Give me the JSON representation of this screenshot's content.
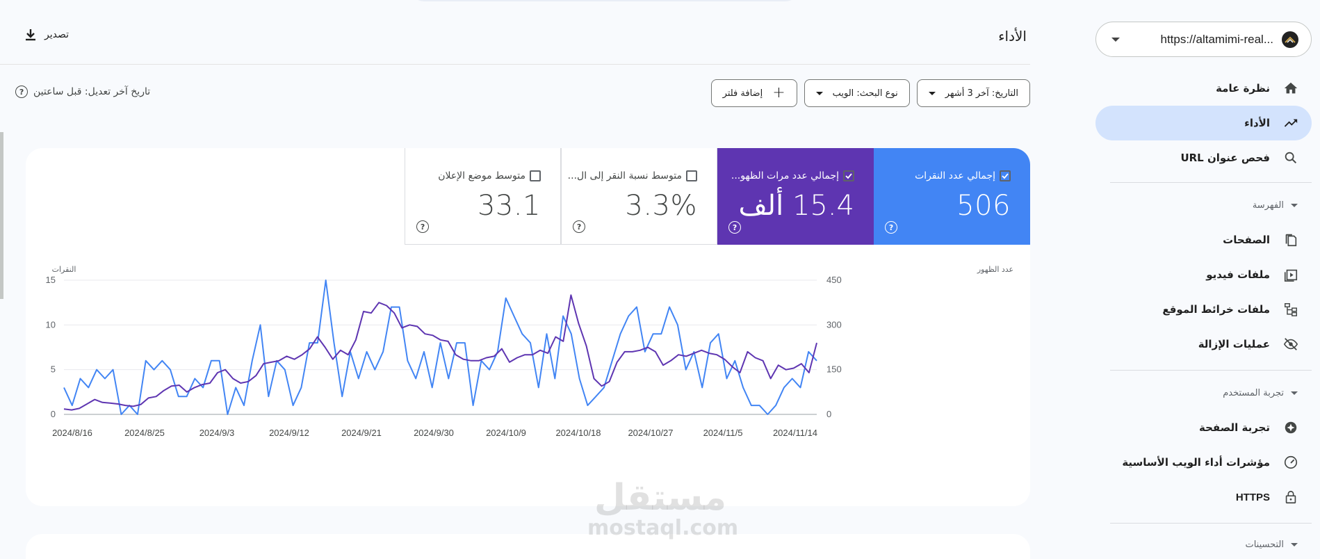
{
  "sidebar": {
    "property_url": "https://altamimi-real...",
    "nav_top": [
      {
        "label": "نظرة عامة",
        "icon": "home-icon"
      },
      {
        "label": "الأداء",
        "icon": "trending-up-icon",
        "active": true
      },
      {
        "label": "فحص عنوان URL",
        "icon": "search-icon"
      }
    ],
    "section_indexing": "الفهرسة",
    "indexing_items": [
      {
        "label": "الصفحات",
        "icon": "pages-icon"
      },
      {
        "label": "ملفات فيديو",
        "icon": "video-icon"
      },
      {
        "label": "ملفات خرائط الموقع",
        "icon": "sitemap-icon"
      },
      {
        "label": "عمليات الإزالة",
        "icon": "eye-off-icon"
      }
    ],
    "section_experience": "تجربة المستخدم",
    "experience_items": [
      {
        "label": "تجربة الصفحة",
        "icon": "page-experience-icon"
      },
      {
        "label": "مؤشرات أداء الويب الأساسية",
        "icon": "speed-icon"
      },
      {
        "label": "HTTPS",
        "icon": "lock-icon"
      }
    ],
    "section_enhancements": "التحسينات"
  },
  "header": {
    "title": "الأداء",
    "export_label": "تصدير"
  },
  "filters": {
    "date": "التاريخ: آخر 3 أشهر",
    "search_type": "نوع البحث: الويب",
    "add_filter": "إضافة فلتر",
    "last_updated": "تاريخ آخر تعديل: قبل ساعتين"
  },
  "metrics": [
    {
      "label": "إجمالي عدد النقرات",
      "value": "506",
      "checked": true,
      "color": "#4285f4"
    },
    {
      "label": "إجمالي عدد مرات الظهو...",
      "value": "15.4 ألف",
      "checked": true,
      "color": "#5e35b1"
    },
    {
      "label": "متوسط نسبة النقر إلى ال...",
      "value": "3.3%",
      "checked": false
    },
    {
      "label": "متوسط موضع الإعلان",
      "value": "33.1",
      "checked": false
    }
  ],
  "watermark": {
    "ar": "مستقل",
    "en": "mostaql.com"
  },
  "chart_data": {
    "type": "line",
    "x_tick_labels": [
      "2024/8/16",
      "2024/8/25",
      "2024/9/3",
      "2024/9/12",
      "2024/9/21",
      "2024/9/30",
      "2024/10/9",
      "2024/10/18",
      "2024/10/27",
      "2024/11/5",
      "2024/11/14"
    ],
    "y_left_label": "النقرات",
    "y_left_ticks": [
      0,
      5,
      10,
      15
    ],
    "y_left_lim": [
      0,
      15
    ],
    "y_right_label": "عدد الظهور",
    "y_right_ticks": [
      0,
      150,
      300,
      450
    ],
    "y_right_lim": [
      0,
      450
    ],
    "grid": true,
    "series": [
      {
        "name": "Clicks",
        "axis": "left",
        "color": "#4285f4",
        "values": [
          3,
          1,
          4,
          3,
          5,
          4,
          5,
          0,
          1,
          0,
          6,
          5,
          6,
          5,
          2,
          2,
          4,
          3,
          6,
          6,
          0,
          3,
          1,
          6,
          10,
          2,
          6,
          5,
          1,
          3,
          8,
          8,
          15,
          8,
          2,
          7,
          4,
          7,
          5,
          7,
          12,
          12,
          6,
          4,
          7,
          3,
          8,
          4,
          8,
          8,
          1,
          6,
          5,
          7,
          13,
          11,
          9,
          8,
          3,
          9,
          4,
          11,
          9,
          4,
          1,
          2,
          3,
          6,
          9,
          11,
          12,
          7,
          9,
          9,
          12,
          10,
          5,
          7,
          3,
          8,
          9,
          4,
          6,
          3,
          1,
          1,
          0,
          1,
          3,
          4,
          3,
          7,
          6
        ]
      },
      {
        "name": "Impressions",
        "axis": "right",
        "color": "#5e35b1",
        "values": [
          18,
          15,
          20,
          35,
          50,
          40,
          38,
          35,
          30,
          27,
          33,
          55,
          60,
          80,
          95,
          98,
          75,
          90,
          100,
          105,
          140,
          150,
          120,
          105,
          110,
          130,
          170,
          175,
          180,
          195,
          185,
          200,
          220,
          260,
          225,
          185,
          215,
          200,
          250,
          345,
          340,
          375,
          365,
          340,
          290,
          300,
          295,
          270,
          265,
          250,
          245,
          200,
          185,
          180,
          180,
          190,
          195,
          220,
          175,
          190,
          200,
          200,
          215,
          205,
          260,
          245,
          400,
          305,
          230,
          120,
          95,
          110,
          175,
          210,
          210,
          215,
          225,
          210,
          165,
          180,
          200,
          195,
          205,
          215,
          205,
          200,
          185,
          160,
          140,
          210,
          190,
          180,
          120,
          165,
          150,
          155,
          170,
          140,
          240
        ]
      }
    ]
  }
}
